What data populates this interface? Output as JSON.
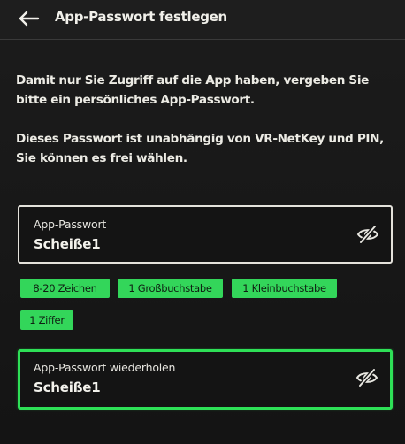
{
  "header": {
    "title": "App-Passwort festlegen",
    "back_icon": "arrow-left-icon"
  },
  "intro": {
    "paragraph1": "Damit nur Sie Zugriff auf die App haben, vergeben Sie bitte ein persönliches App-Passwort.",
    "paragraph2": "Dieses Passwort ist unabhängig von VR-NetKey und PIN, Sie können es frei wählen."
  },
  "password_field": {
    "label": "App-Passwort",
    "value": "Scheiße1",
    "toggle_icon": "eye-slash-icon"
  },
  "requirements": [
    {
      "label": "8-20 Zeichen",
      "met": true
    },
    {
      "label": "1 Großbuchstabe",
      "met": true
    },
    {
      "label": "1 Kleinbuchstabe",
      "met": true
    },
    {
      "label": "1 Ziffer",
      "met": true
    }
  ],
  "repeat_field": {
    "label": "App-Passwort wiederholen",
    "value": "Scheiße1",
    "toggle_icon": "eye-slash-icon"
  },
  "colors": {
    "background": "#161616",
    "text": "#ecebe6",
    "accent_green": "#33d65a",
    "focus_border": "#2ee057",
    "field_border": "#e4e2db"
  }
}
